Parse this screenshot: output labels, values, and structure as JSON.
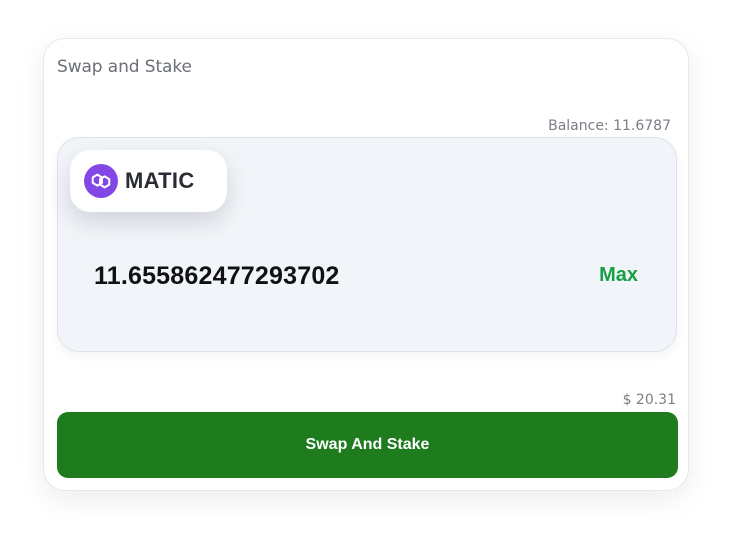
{
  "card": {
    "title": "Swap and Stake",
    "balance": "Balance: 11.6787",
    "token": {
      "symbol": "MATIC",
      "icon": "polygon-matic-icon",
      "icon_color": "#8247e5"
    },
    "amount_value": "11.655862477293702",
    "max_label": "Max",
    "usd_value": "$ 20.31",
    "action_label": "Swap And Stake"
  },
  "colors": {
    "accent_button": "#1e7b1e",
    "max_text": "#18a046",
    "token_box_bg": "#f1f4f8"
  }
}
